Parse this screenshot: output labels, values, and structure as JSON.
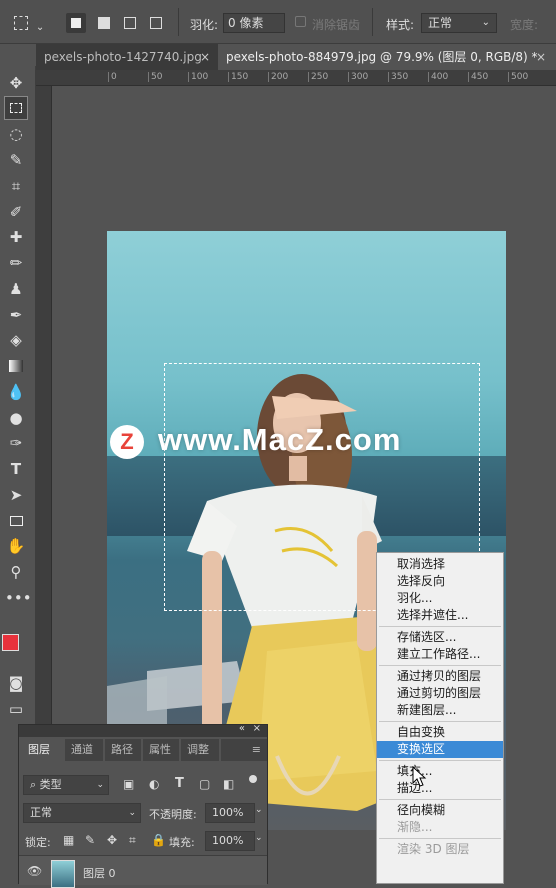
{
  "options_bar": {
    "feather_label": "羽化:",
    "feather_value": "0 像素",
    "antialias_label": "消除锯齿",
    "style_label": "样式:",
    "style_value": "正常",
    "width_label": "宽度:"
  },
  "tabs": [
    {
      "label": "pexels-photo-1427740.jpg",
      "close": "×",
      "active": false
    },
    {
      "label": "pexels-photo-884979.jpg @ 79.9% (图层 0, RGB/8) *",
      "close": "×",
      "active": true
    }
  ],
  "ruler_h_ticks": [
    "0",
    "50",
    "100",
    "150",
    "200",
    "250",
    "300",
    "350",
    "400",
    "450",
    "500"
  ],
  "watermark": {
    "logo_letter": "Z",
    "text": "www.MacZ.com"
  },
  "context_menu": [
    {
      "label": "取消选择",
      "state": "normal"
    },
    {
      "label": "选择反向",
      "state": "normal"
    },
    {
      "label": "羽化...",
      "state": "normal"
    },
    {
      "label": "选择并遮住...",
      "state": "normal"
    },
    {
      "sep": true
    },
    {
      "label": "存储选区...",
      "state": "normal"
    },
    {
      "label": "建立工作路径...",
      "state": "normal"
    },
    {
      "sep": true
    },
    {
      "label": "通过拷贝的图层",
      "state": "normal"
    },
    {
      "label": "通过剪切的图层",
      "state": "normal"
    },
    {
      "label": "新建图层...",
      "state": "normal"
    },
    {
      "sep": true
    },
    {
      "label": "自由变换",
      "state": "normal"
    },
    {
      "label": "变换选区",
      "state": "selected"
    },
    {
      "sep": true
    },
    {
      "label": "填充...",
      "state": "normal"
    },
    {
      "label": "描边...",
      "state": "normal"
    },
    {
      "sep": true
    },
    {
      "label": "径向模糊",
      "state": "normal"
    },
    {
      "label": "渐隐...",
      "state": "disabled"
    },
    {
      "sep": true
    },
    {
      "label": "渲染 3D 图层",
      "state": "disabled"
    }
  ],
  "layers_panel": {
    "tabs": [
      "图层",
      "通道",
      "路径",
      "属性",
      "调整"
    ],
    "filter_label": "类型",
    "blend_mode": "正常",
    "opacity_label": "不透明度:",
    "opacity_value": "100%",
    "lock_label": "锁定:",
    "fill_label": "填充:",
    "fill_value": "100%",
    "layer_name": "图层 0"
  },
  "colors": {
    "foreground": "#e8323c",
    "background": "#111111",
    "menu_highlight": "#3b8ad6",
    "watermark_logo": "#e8433a"
  }
}
